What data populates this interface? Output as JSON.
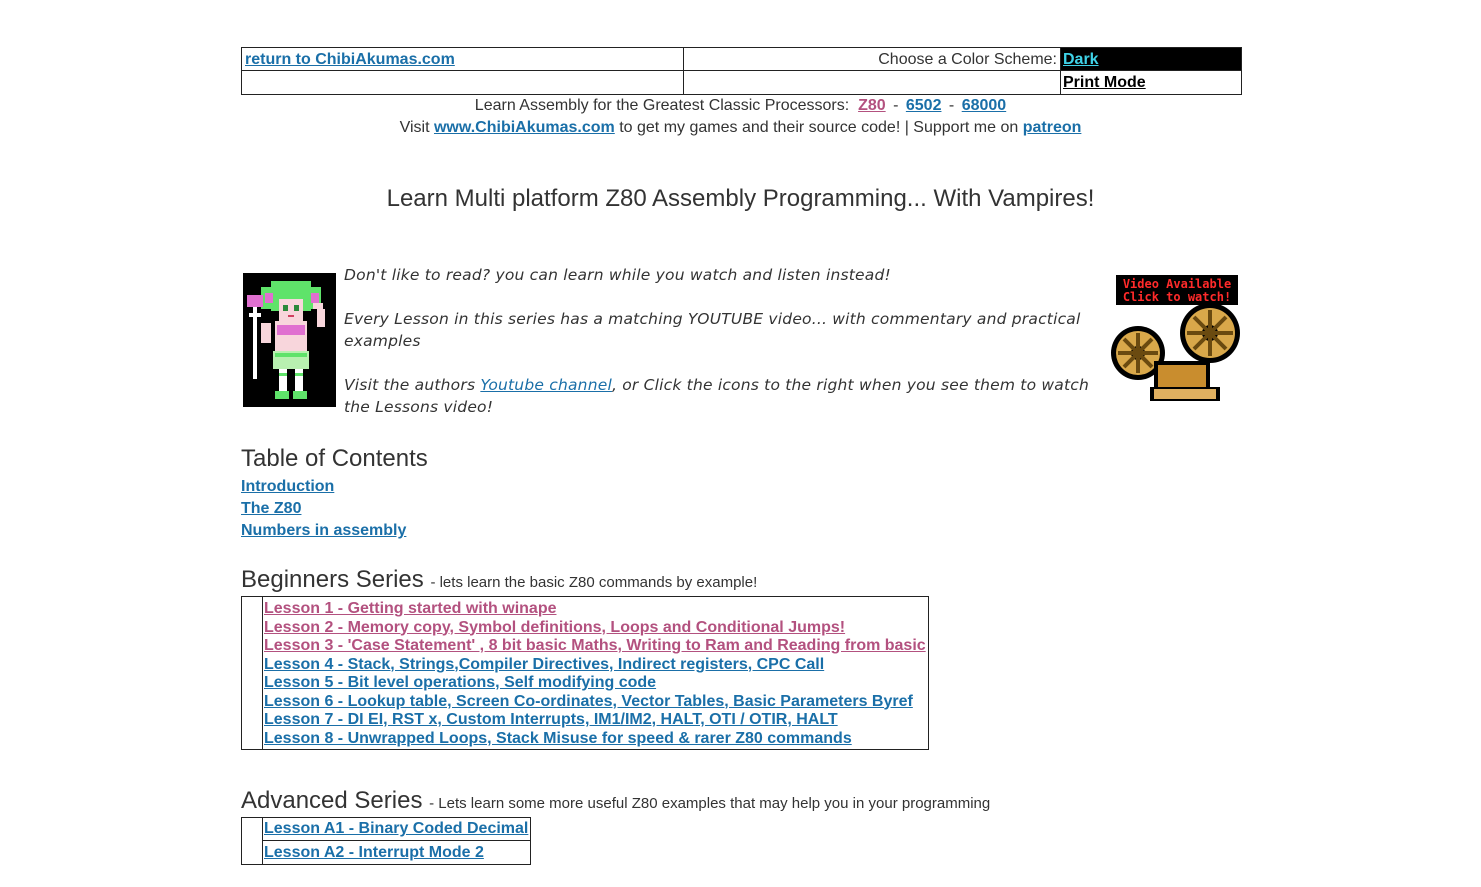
{
  "header": {
    "return_link": "return to ChibiAkumas.com",
    "color_scheme_label": "Choose a Color Scheme:",
    "dark_option": "Dark",
    "print_option": "Print Mode"
  },
  "banner": {
    "processors_text": "Learn Assembly for the Greatest Classic Processors:",
    "proc_z80": "Z80",
    "proc_6502": "6502",
    "proc_68000": "68000",
    "sep1": "-",
    "sep2": "-",
    "visit_prefix": "Visit",
    "site_link": "www.ChibiAkumas.com",
    "visit_mid": "to get my games and their source code! | Support me on",
    "patreon_link": "patreon"
  },
  "page_title": "Learn Multi platform Z80 Assembly Programming... With Vampires!",
  "intro": {
    "p1": "Don't like to read? you can learn while you watch and listen instead!",
    "p2": "Every Lesson in this series has a matching YOUTUBE video... with commentary and practical examples",
    "p3_prefix": "Visit the authors",
    "p3_link": "Youtube channel",
    "p3_suffix": ", or Click the icons to the right when you see them to watch the Lessons video!",
    "video_badge_line1": "Video Available",
    "video_badge_line2": "Click to watch!"
  },
  "toc": {
    "title": "Table of Contents",
    "items": [
      "Introduction",
      "The Z80",
      "Numbers in assembly"
    ]
  },
  "beginners": {
    "title": "Beginners Series",
    "subtitle": "- lets learn the basic Z80 commands by example!",
    "lessons": [
      "Lesson 1 - Getting started with winape",
      "Lesson 2 - Memory copy, Symbol definitions, Loops and Conditional Jumps!",
      "Lesson 3 - 'Case Statement' , 8 bit basic Maths, Writing to Ram and Reading from basic",
      "Lesson 4 - Stack, Strings,Compiler Directives, Indirect registers, CPC Call",
      "Lesson 5 - Bit level operations, Self modifying code",
      "Lesson 6 -  Lookup table, Screen Co-ordinates, Vector Tables, Basic Parameters Byref",
      "Lesson 7 - DI EI, RST x, Custom Interrupts, IM1/IM2, HALT, OTI / OTIR, HALT",
      "Lesson 8 - Unwrapped Loops, Stack Misuse for speed & rarer Z80 commands"
    ]
  },
  "advanced": {
    "title": "Advanced Series",
    "subtitle": "- Lets learn some more useful Z80 examples that may help you in your programming",
    "lessons": [
      "Lesson A1 - Binary Coded Decimal",
      "Lesson A2 - Interrupt Mode 2"
    ]
  },
  "colors": {
    "link": "#1a6fa8",
    "visited_link": "#b3517f",
    "dark_cell_bg": "#000000",
    "dark_link": "#3fd3e8"
  }
}
